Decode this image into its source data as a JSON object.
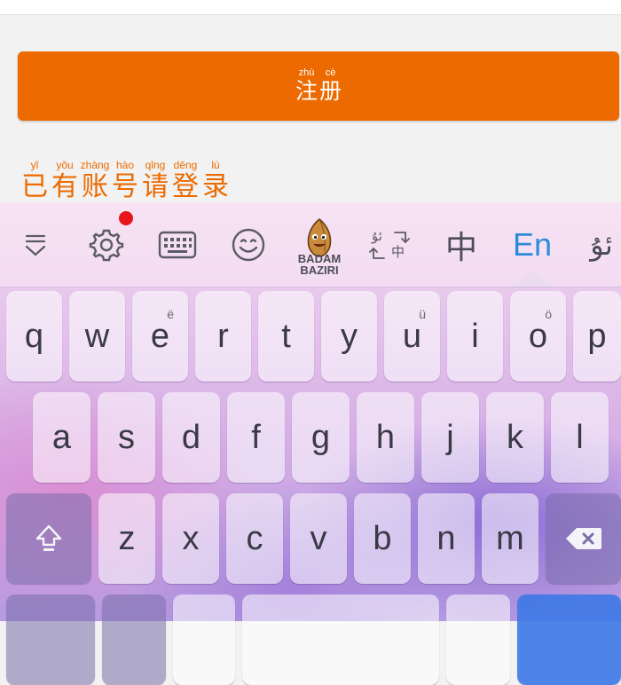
{
  "register_button": {
    "chars": [
      {
        "pinyin": "zhù",
        "hanzi": "注"
      },
      {
        "pinyin": "cè",
        "hanzi": "册"
      }
    ]
  },
  "login_link": {
    "chars": [
      {
        "pinyin": "yǐ",
        "hanzi": "已"
      },
      {
        "pinyin": "yǒu",
        "hanzi": "有"
      },
      {
        "pinyin": "zhàng",
        "hanzi": "账"
      },
      {
        "pinyin": "hào",
        "hanzi": "号"
      },
      {
        "pinyin": "qǐng",
        "hanzi": "请"
      },
      {
        "pinyin": "dēng",
        "hanzi": "登"
      },
      {
        "pinyin": "lù",
        "hanzi": "录"
      }
    ]
  },
  "keyboard": {
    "toolbar": {
      "logo_line1": "BADAM",
      "logo_line2": "BAZIRI",
      "chinese_label": "中",
      "english_label": "En",
      "uyghur_label": "ئۇ",
      "switch_label_left": "ئۇ",
      "switch_label_right": "中",
      "settings_has_notification": true
    },
    "row1": [
      {
        "label": "q",
        "alt": ""
      },
      {
        "label": "w",
        "alt": ""
      },
      {
        "label": "e",
        "alt": "ë"
      },
      {
        "label": "r",
        "alt": ""
      },
      {
        "label": "t",
        "alt": ""
      },
      {
        "label": "y",
        "alt": ""
      },
      {
        "label": "u",
        "alt": "ü"
      },
      {
        "label": "i",
        "alt": ""
      },
      {
        "label": "o",
        "alt": "ö"
      },
      {
        "label": "p",
        "alt": ""
      }
    ],
    "row2": [
      "a",
      "s",
      "d",
      "f",
      "g",
      "h",
      "j",
      "k",
      "l"
    ],
    "row3": [
      "z",
      "x",
      "c",
      "v",
      "b",
      "n",
      "m"
    ],
    "colors": {
      "accent": "#ec6a00",
      "en_blue": "#2c8bd8",
      "notify_red": "#e8151c"
    }
  }
}
